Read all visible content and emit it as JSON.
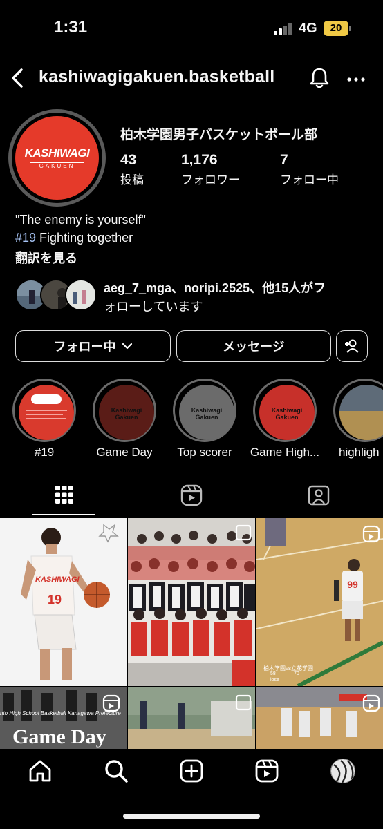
{
  "status_bar": {
    "time": "1:31",
    "network": "4G",
    "battery": "20"
  },
  "header": {
    "username": "kashiwagigakuen.basketball_"
  },
  "profile": {
    "avatar_text_top": "KASHIWAGI",
    "avatar_text_bottom": "GAKUEN",
    "display_name": "柏木学園男子バスケットボール部",
    "stats": [
      {
        "value": "43",
        "label": "投稿"
      },
      {
        "value": "1,176",
        "label": "フォロワー"
      },
      {
        "value": "7",
        "label": "フォロー中"
      }
    ],
    "bio_line1": "\"The enemy is yourself\"",
    "bio_line2": "#19 Fighting together",
    "translate": "翻訳を見る",
    "mutual_line1": "aeg_7_mga、noripi.2525、他15人がフ",
    "mutual_line2": "ォローしています"
  },
  "actions": {
    "following": "フォロー中",
    "message": "メッセージ"
  },
  "highlights": [
    {
      "label": "#19",
      "cover_text": "",
      "color": "#d93a2d"
    },
    {
      "label": "Game Day",
      "cover_text": "Kashiwagi Gakuen",
      "color": "#5a1c17"
    },
    {
      "label": "Top scorer",
      "cover_text": "Kashiwagi Gakuen",
      "color": "#6b6b6b"
    },
    {
      "label": "Game High...",
      "cover_text": "Kashiwagi Gakuen",
      "color": "#c7302a"
    },
    {
      "label": "highligh",
      "cover_text": "",
      "color": "#8c7a4a"
    }
  ],
  "grid": {
    "post1_number": "19",
    "post1_jersey": "KASHIWAGI",
    "post3_number": "99",
    "post3_caption": "柏木学園vs立花学園",
    "post3_score_a": "58",
    "post3_score_b": "70",
    "post3_result": "lose",
    "post4_banner": "nto High School Basketball Kanagawa Prefecture",
    "post4_title": "Game Day"
  }
}
